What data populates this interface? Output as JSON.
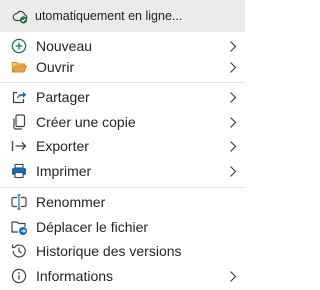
{
  "status": {
    "text": "utomatiquement en ligne...",
    "icon": "cloud-check-icon",
    "accent": "#107c41"
  },
  "menu": {
    "items": [
      {
        "label": "Nouveau",
        "icon": "plus-circle-icon",
        "submenu": true
      },
      {
        "label": "Ouvrir",
        "icon": "folder-open-icon",
        "submenu": true
      },
      {
        "label": "Partager",
        "icon": "share-icon",
        "submenu": true
      },
      {
        "label": "Créer une copie",
        "icon": "copy-icon",
        "submenu": true
      },
      {
        "label": "Exporter",
        "icon": "export-icon",
        "submenu": true
      },
      {
        "label": "Imprimer",
        "icon": "printer-icon",
        "submenu": true
      },
      {
        "label": "Renommer",
        "icon": "rename-icon",
        "submenu": false
      },
      {
        "label": "Déplacer le fichier",
        "icon": "move-file-icon",
        "submenu": false
      },
      {
        "label": "Historique des versions",
        "icon": "history-icon",
        "submenu": false
      },
      {
        "label": "Informations",
        "icon": "info-icon",
        "submenu": true
      }
    ]
  },
  "colors": {
    "icon_stroke": "#424242",
    "plus_green": "#107c41",
    "folder_orange": "#e8a33c",
    "share_blue": "#0f6cbd",
    "print_blue": "#0f6cbd"
  }
}
